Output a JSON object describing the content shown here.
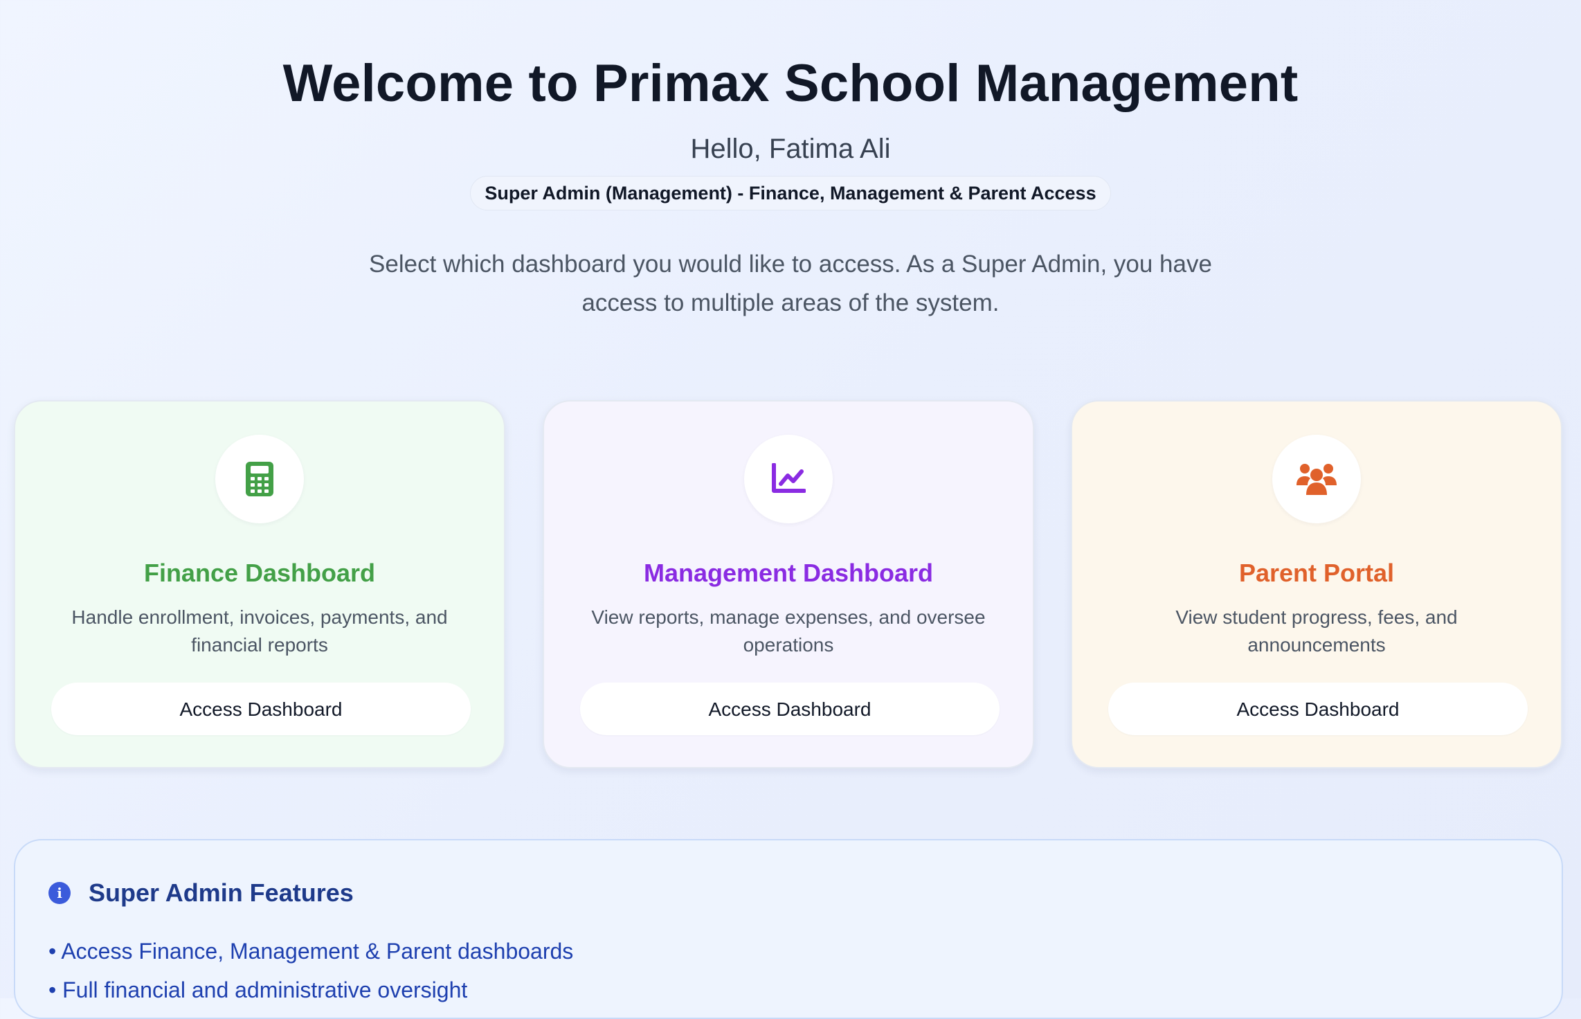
{
  "header": {
    "title": "Welcome to Primax School Management",
    "greeting": "Hello, Fatima Ali",
    "role_badge": "Super Admin (Management) - Finance, Management & Parent Access",
    "intro": "Select which dashboard you would like to access. As a Super Admin, you have access to multiple areas of the system."
  },
  "cards": [
    {
      "icon": "calculator-icon",
      "title": "Finance Dashboard",
      "description": "Handle enrollment, invoices, payments, and financial reports",
      "button_label": "Access Dashboard",
      "accent_color": "#43a047",
      "background_color": "#f0fbf3"
    },
    {
      "icon": "chart-line-icon",
      "title": "Management Dashboard",
      "description": "View reports, manage expenses, and oversee operations",
      "button_label": "Access Dashboard",
      "accent_color": "#8a2be2",
      "background_color": "#f6f4fe"
    },
    {
      "icon": "users-icon",
      "title": "Parent Portal",
      "description": "View student progress, fees, and announcements",
      "button_label": "Access Dashboard",
      "accent_color": "#e0612b",
      "background_color": "#fdf7ec"
    }
  ],
  "features": {
    "icon": "info-icon",
    "icon_glyph": "i",
    "title": "Super Admin Features",
    "items": [
      "• Access Finance, Management & Parent dashboards",
      "• Full financial and administrative oversight"
    ]
  }
}
